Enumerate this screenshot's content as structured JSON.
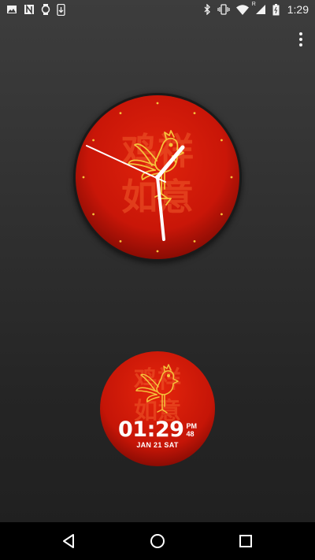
{
  "status_bar": {
    "time": "1:29",
    "left_icons": [
      "image-icon",
      "n-icon",
      "watch-icon",
      "phone-download-icon"
    ],
    "right_icons": [
      "bluetooth-icon",
      "vibrate-icon",
      "wifi-icon",
      "signal-icon",
      "battery-icon"
    ],
    "signal_roaming_label": "R"
  },
  "menu": {
    "icon": "more-vert-icon"
  },
  "analog_watch": {
    "background_chars_line1": "鸡祥",
    "background_chars_line2": "如意",
    "face_color": "#d61a08",
    "accent_color": "#f5c33b"
  },
  "digital_watch": {
    "time": "01:29",
    "ampm": "PM",
    "seconds": "48",
    "date": "JAN 21 SAT",
    "background_chars_line1": "鸡祥",
    "background_chars_line2": "如意"
  },
  "nav_bar": {
    "icons": [
      "back-icon",
      "home-icon",
      "recents-icon"
    ]
  }
}
